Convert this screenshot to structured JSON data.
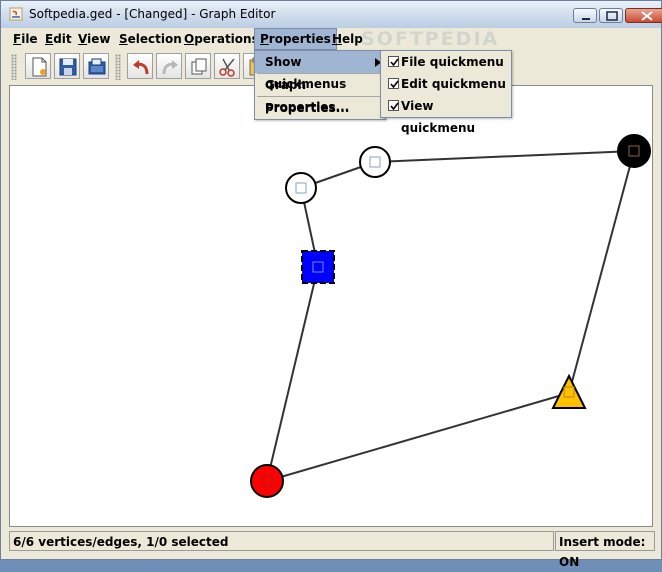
{
  "window": {
    "title": "Softpedia.ged - [Changed] - Graph Editor"
  },
  "watermark": "SOFTPEDIA",
  "menubar": {
    "file": {
      "mnemonic": "F",
      "rest": "ile"
    },
    "edit": {
      "mnemonic": "E",
      "rest": "dit"
    },
    "view": {
      "mnemonic": "V",
      "rest": "iew"
    },
    "selection": {
      "mnemonic": "S",
      "rest": "election"
    },
    "operations": {
      "mnemonic": "O",
      "rest": "perations"
    },
    "properties": {
      "mnemonic": "P",
      "rest": "roperties"
    },
    "help": {
      "mnemonic": "H",
      "rest": "elp"
    }
  },
  "toolbar": {
    "icons": [
      "new-file-icon",
      "save-icon",
      "open-folder-icon",
      "undo-icon",
      "redo-icon",
      "copy-icon",
      "cut-icon",
      "paste-icon"
    ]
  },
  "properties_menu": {
    "items": [
      {
        "label": "Show quickmenus",
        "has_submenu": true
      },
      {
        "label": "Graph properties..."
      },
      {
        "label": "Properties..."
      }
    ]
  },
  "quickmenus_submenu": {
    "items": [
      {
        "label": "File quickmenu",
        "checked": true
      },
      {
        "label": "Edit quickmenu",
        "checked": true
      },
      {
        "label": "View quickmenu",
        "checked": true
      }
    ]
  },
  "graph": {
    "vertices": [
      {
        "id": "v1",
        "shape": "circle",
        "fill": "#ffffff"
      },
      {
        "id": "v2",
        "shape": "circle",
        "fill": "#ffffff"
      },
      {
        "id": "v3",
        "shape": "circle",
        "fill": "#000000"
      },
      {
        "id": "v4",
        "shape": "square",
        "fill": "#0000ff",
        "selected": true
      },
      {
        "id": "v5",
        "shape": "triangle",
        "fill": "#ffc000"
      },
      {
        "id": "v6",
        "shape": "circle",
        "fill": "#ff0000"
      }
    ],
    "edges": [
      [
        "v1",
        "v2"
      ],
      [
        "v2",
        "v3"
      ],
      [
        "v1",
        "v4"
      ],
      [
        "v4",
        "v6"
      ],
      [
        "v6",
        "v5"
      ],
      [
        "v5",
        "v3"
      ]
    ]
  },
  "status": {
    "left": "6/6 vertices/edges, 1/0 selected",
    "right": "Insert mode: ON"
  }
}
